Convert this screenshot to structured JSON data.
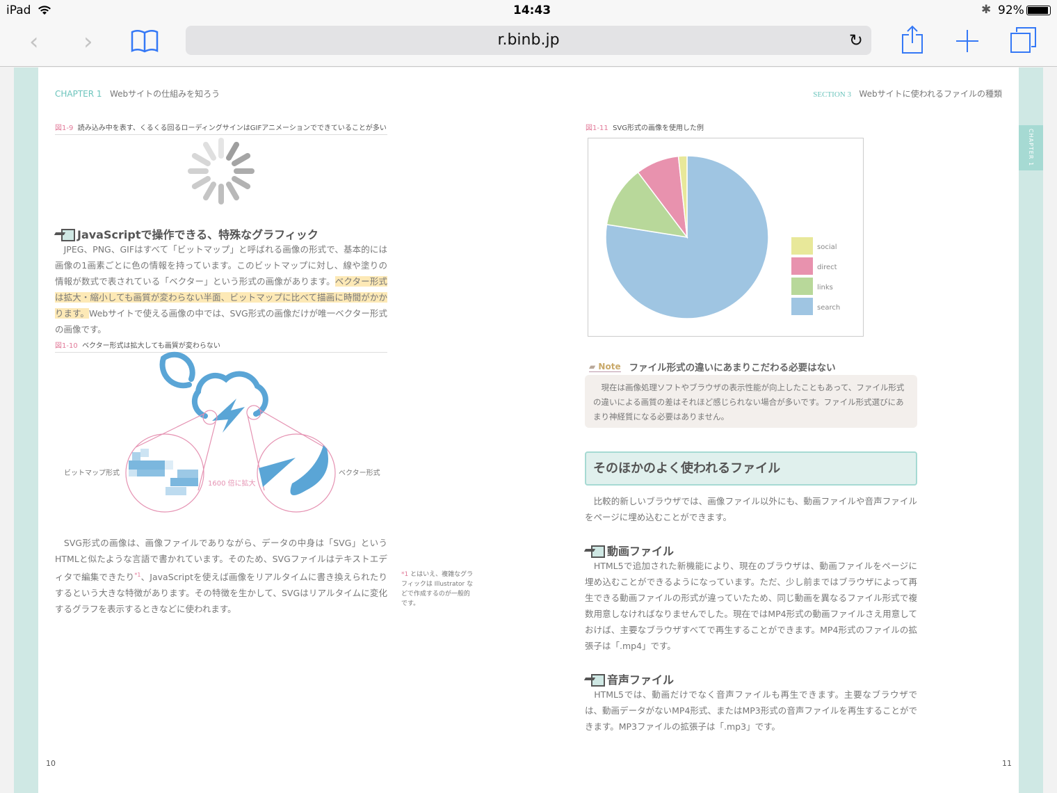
{
  "status_bar": {
    "device": "iPad",
    "time": "14:43",
    "battery": "92%",
    "battery_level": 0.92
  },
  "toolbar": {
    "url": "r.binb.jp",
    "icons": [
      "back-icon",
      "forward-icon",
      "bookmarks-icon",
      "reload-icon",
      "share-icon",
      "new-tab-icon",
      "tabs-icon"
    ]
  },
  "left_page": {
    "chapter_label": "CHAPTER 1",
    "chapter_title": "Webサイトの仕組みを知ろう",
    "fig9_num": "図1-9",
    "fig9_caption": "読み込み中を表す、くるくる回るローディングサインはGIFアニメーションでできていることが多い",
    "heading": "JavaScriptで操作できる、特殊なグラフィック",
    "para1_a": "　JPEG、PNG、GIFはすべて「ビットマップ」と呼ばれる画像の形式で、基本的には画像の1画素ごとに色の情報を持っています。このビットマップに対し、線や塗りの情報が数式で表されている「ベクター」という形式の画像があります。",
    "para1_hl": "ベクター形式は拡大・縮小しても画質が変わらない半面、ビットマップに比べて描画に時間がかかります。",
    "para1_b": "Webサイトで使える画像の中では、SVG形式の画像だけが唯一ベクター形式の画像です。",
    "fig10_num": "図1-10",
    "fig10_caption": "ベクター形式は拡大しても画質が変わらない",
    "fig10_bitmap": "ビットマップ形式",
    "fig10_zoom": "1600 倍に拡大",
    "fig10_vector": "ベクター形式",
    "para2_a": "　SVG形式の画像は、画像ファイルでありながら、データの中身は「SVG」というHTMLと似たような言語で書かれています。そのため、SVGファイルはテキストエディタで編集できたり",
    "para2_ref": "*1",
    "para2_b": "、JavaScriptを使えば画像をリアルタイムに書き換えられたりするという大きな特徴があります。その特徴を生かして、SVGはリアルタイムに変化するグラフを表示するときなどに使われます。",
    "footnote_mark": "*1",
    "footnote": "とはいえ、複雑なグラフィックは Illustrator などで作成するのが一般的です。",
    "page_number": "10"
  },
  "right_page": {
    "section_label": "SECTION 3",
    "section_title": "Webサイトに使われるファイルの種類",
    "side_tab": "CHAPTER 1",
    "fig11_num": "図1-11",
    "fig11_caption": "SVG形式の画像を使用した例",
    "note_label": "Note",
    "note_title": "ファイル形式の違いにあまりこだわる必要はない",
    "note_body": "　現在は画像処理ソフトやブラウザの表示性能が向上したこともあって、ファイル形式の違いによる画質の差はそれほど感じられない場合が多いです。ファイル形式選びにあまり神経質になる必要はありません。",
    "section_heading": "そのほかのよく使われるファイル",
    "intro": "　比較的新しいブラウザでは、画像ファイル以外にも、動画ファイルや音声ファイルをページに埋め込むことができます。",
    "video_heading": "動画ファイル",
    "video_body": "　HTML5で追加された新機能により、現在のブラウザは、動画ファイルをページに埋め込むことができるようになっています。ただ、少し前まではブラウザによって再生できる動画ファイルの形式が違っていたため、同じ動画を異なるファイル形式で複数用意しなければなりませんでした。現在ではMP4形式の動画ファイルさえ用意しておけば、主要なブラウザすべてで再生することができます。MP4形式のファイルの拡張子は「.mp4」です。",
    "audio_heading": "音声ファイル",
    "audio_body": "　HTML5では、動画だけでなく音声ファイルも再生できます。主要なブラウザでは、動画データがないMP4形式、またはMP3形式の音声ファイルを再生することができます。MP3ファイルの拡張子は「.mp3」です。",
    "page_number": "11"
  },
  "chart_data": {
    "type": "pie",
    "categories": [
      "search",
      "links",
      "direct",
      "social"
    ],
    "values": [
      77.5,
      12.2,
      8.6,
      1.7
    ],
    "colors": [
      "#9fc5e2",
      "#b8d89a",
      "#e892ae",
      "#e8e89a"
    ],
    "legend": [
      "social",
      "direct",
      "links",
      "search"
    ],
    "legend_placement": "bottom-right"
  }
}
